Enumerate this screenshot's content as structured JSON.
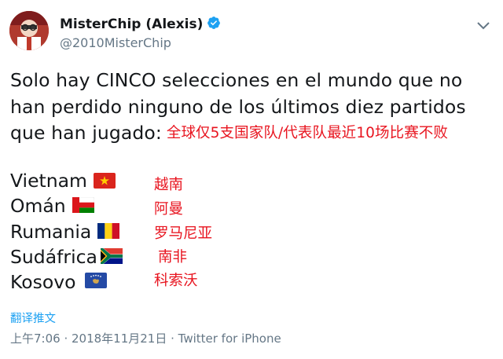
{
  "author": {
    "name": "MisterChip (Alexis)",
    "handle": "@2010MisterChip"
  },
  "tweet": {
    "lines": [
      "Solo hay CINCO selecciones en el mundo que no",
      "han perdido ninguno de los últimos diez partidos",
      "que han jugado:"
    ],
    "translation_note": "全球仅5支国家队/代表队最近10场比赛不败",
    "countries": [
      {
        "name": "Vietnam",
        "flag": "vietnam-flag",
        "chinese": "越南"
      },
      {
        "name": "Omán",
        "flag": "oman-flag",
        "chinese": "阿曼"
      },
      {
        "name": "Rumania",
        "flag": "romania-flag",
        "chinese": "罗马尼亚"
      },
      {
        "name": "Sudáfrica",
        "flag": "south-africa-flag",
        "chinese": "南非"
      },
      {
        "name": "Kosovo",
        "flag": "kosovo-flag",
        "chinese": "科索沃"
      }
    ]
  },
  "footer": {
    "translate_label": "翻译推文",
    "meta": "上午7:06 · 2018年11月21日 · Twitter for iPhone"
  },
  "colors": {
    "link": "#1da1f2",
    "annotation_red": "#e8141f",
    "secondary_text": "#657786"
  },
  "icons": [
    "verified-badge-icon",
    "chevron-down-icon"
  ]
}
